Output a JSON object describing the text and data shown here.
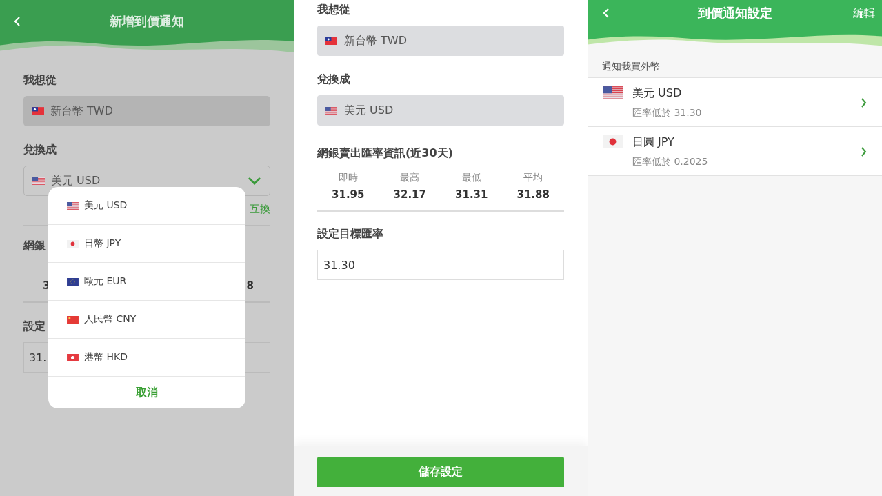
{
  "add_alert_screen": {
    "title": "新增到價通知",
    "from_label": "我想從",
    "from_currency": {
      "kind": "tw",
      "label": "新台幣 TWD"
    },
    "to_label": "兌換成",
    "to_currency": {
      "kind": "us",
      "label": "美元 USD"
    },
    "swap_link": "互換",
    "rates_title": "網銀",
    "rate_now": "3",
    "rate_avg": "8",
    "target_label": "設定",
    "target_value": "31.",
    "picker": {
      "options": [
        {
          "kind": "us",
          "label": "美元 USD"
        },
        {
          "kind": "jp",
          "label": "日幣 JPY"
        },
        {
          "kind": "eu",
          "label": "歐元 EUR"
        },
        {
          "kind": "cn",
          "label": "人民幣 CNY"
        },
        {
          "kind": "hk",
          "label": "港幣 HKD"
        }
      ],
      "cancel": "取消"
    }
  },
  "target_rate_screen": {
    "from_label": "我想從",
    "from_currency": {
      "kind": "tw",
      "label": "新台幣 TWD"
    },
    "to_label": "兌換成",
    "to_currency": {
      "kind": "us",
      "label": "美元 USD"
    },
    "rates_title": "網銀賣出匯率資訊(近30天)",
    "stats": [
      {
        "label": "即時",
        "value": "31.95"
      },
      {
        "label": "最高",
        "value": "32.17"
      },
      {
        "label": "最低",
        "value": "31.31"
      },
      {
        "label": "平均",
        "value": "31.88"
      }
    ],
    "target_label": "設定目標匯率",
    "target_value": "31.30",
    "save_button": "儲存設定"
  },
  "alert_settings_screen": {
    "title": "到價通知設定",
    "edit": "編輯",
    "section": "通知我買外幣",
    "alerts": [
      {
        "kind": "us",
        "currency": "美元 USD",
        "condition": "匯率低於 31.30"
      },
      {
        "kind": "jp",
        "currency": "日圓 JPY",
        "condition": "匯率低於 0.2025"
      }
    ]
  }
}
